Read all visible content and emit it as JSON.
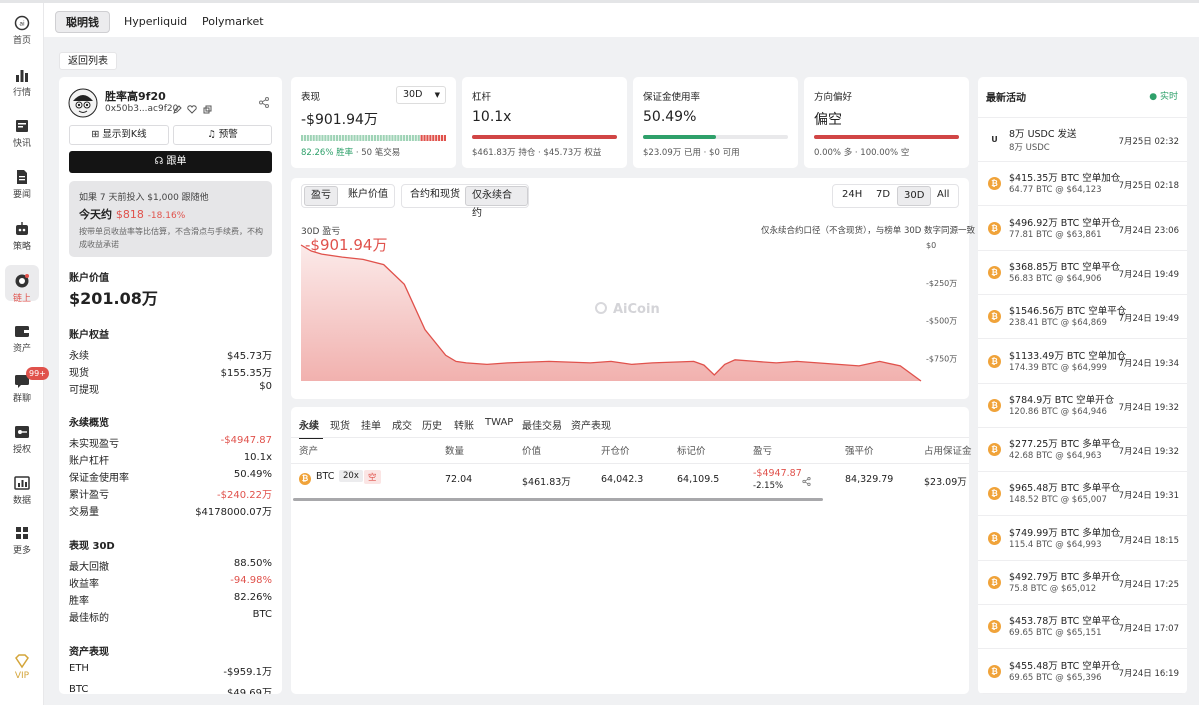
{
  "sidebar": {
    "items": [
      {
        "label": "首页",
        "icon": "ai-logo-icon"
      },
      {
        "label": "行情",
        "icon": "bar-chart-icon"
      },
      {
        "label": "快讯",
        "icon": "news-flash-icon"
      },
      {
        "label": "要闻",
        "icon": "document-icon"
      },
      {
        "label": "策略",
        "icon": "robot-icon"
      },
      {
        "label": "链上",
        "icon": "chain-icon"
      },
      {
        "label": "资产",
        "icon": "wallet-icon"
      },
      {
        "label": "群聊",
        "icon": "chat-icon",
        "badge": "99+"
      },
      {
        "label": "授权",
        "icon": "key-icon"
      },
      {
        "label": "数据",
        "icon": "data-chart-icon"
      },
      {
        "label": "更多",
        "icon": "grid-more-icon"
      },
      {
        "label": "VIP",
        "icon": "diamond-icon"
      }
    ]
  },
  "top_tabs": [
    "聪明钱",
    "Hyperliquid",
    "Polymarket"
  ],
  "back_label": "返回列表",
  "profile": {
    "name": "胜率高9f20",
    "address": "0x50b3...ac9f20",
    "kline_btn": "显示到K线",
    "alert_btn": "预警",
    "follow_btn": "跟单",
    "sim": {
      "line1": "如果 7 天前投入 $1,000 跟随他",
      "today_prefix": "今天约",
      "today_value": "$818",
      "today_pct": "-18.16%",
      "disclaimer1": "按带单员收益率等比估算，不含滑点与手续费，不构",
      "disclaimer2": "成收益承诺"
    },
    "account_value_label": "账户价值",
    "account_value": "$201.08万",
    "equity_title": "账户权益",
    "equity": [
      {
        "k": "永续",
        "v": "$45.73万"
      },
      {
        "k": "现货",
        "v": "$155.35万"
      },
      {
        "k": "可提现",
        "v": "$0"
      }
    ],
    "perp_title": "永续概览",
    "perp": [
      {
        "k": "未实现盈亏",
        "v": "-$4947.87",
        "neg": true
      },
      {
        "k": "账户杠杆",
        "v": "10.1x"
      },
      {
        "k": "保证金使用率",
        "v": "50.49%"
      },
      {
        "k": "累计盈亏",
        "v": "-$240.22万",
        "neg": true
      },
      {
        "k": "交易量",
        "v": "$4178000.07万"
      }
    ],
    "perf_title": "表现 30D",
    "perf": [
      {
        "k": "最大回撤",
        "v": "88.50%"
      },
      {
        "k": "收益率",
        "v": "-94.98%",
        "neg": true
      },
      {
        "k": "胜率",
        "v": "82.26%"
      },
      {
        "k": "最佳标的",
        "v": "BTC"
      }
    ],
    "asset_title": "资产表现",
    "assets": [
      {
        "k": "ETH",
        "v": "-$959.1万"
      },
      {
        "k": "BTC",
        "v": "$49.69万"
      }
    ]
  },
  "stats": {
    "perf": {
      "label": "表现",
      "period": "30D",
      "value": "-$901.94万",
      "win_rate": "82.26% 胜率",
      "trades": "· 50 笔交易",
      "win_fraction": 0.8226
    },
    "leverage": {
      "label": "杠杆",
      "value": "10.1x",
      "sub": "$461.83万 持仓 · $45.73万 权益",
      "fill": 1.0
    },
    "margin": {
      "label": "保证金使用率",
      "value": "50.49%",
      "sub": "$23.09万 已用 · $0 可用",
      "fill": 0.5049
    },
    "bias": {
      "label": "方向偏好",
      "value": "偏空",
      "sub": "0.00% 多 · 100.00% 空",
      "fill": 1.0
    }
  },
  "chart_panel": {
    "segs_a": [
      "盈亏",
      "账户价值"
    ],
    "segs_b": [
      "合约和现货",
      "仅永续合约"
    ],
    "ranges": [
      "24H",
      "7D",
      "30D",
      "All"
    ],
    "title": "30D 盈亏",
    "value": "-$901.94万",
    "note": "仅永续合约口径（不含现货），与榜单 30D 数字同源一致",
    "watermark": "AiCoin"
  },
  "chart_data": {
    "type": "area",
    "title": "30D 盈亏",
    "ylim": [
      -900,
      0
    ],
    "yticks": [
      "$0",
      "-$250万",
      "-$500万",
      "-$750万"
    ],
    "ytick_values": [
      0,
      -250,
      -500,
      -750
    ],
    "x": [
      0,
      0.5,
      1,
      2,
      3,
      4,
      5,
      6,
      7,
      7.5,
      8,
      9,
      10,
      11,
      12,
      13,
      14,
      15,
      16,
      17,
      18,
      19,
      19.5,
      20,
      20.5,
      21,
      22,
      23,
      24,
      25,
      26,
      27,
      28,
      29,
      30
    ],
    "values": [
      0,
      -40,
      -60,
      -80,
      -95,
      -130,
      -260,
      -560,
      -730,
      -770,
      -780,
      -790,
      -780,
      -775,
      -770,
      -775,
      -780,
      -770,
      -790,
      -780,
      -775,
      -770,
      -795,
      -860,
      -790,
      -760,
      -770,
      -780,
      -770,
      -780,
      -790,
      -800,
      -770,
      -800,
      -900
    ]
  },
  "positions": {
    "tabs": [
      "永续",
      "现货",
      "挂单",
      "成交",
      "历史",
      "转账",
      "TWAP",
      "最佳交易",
      "资产表现"
    ],
    "headers": [
      "资产",
      "数量",
      "价值",
      "开仓价",
      "标记价",
      "盈亏",
      "强平价",
      "占用保证金"
    ],
    "row": {
      "asset": "BTC",
      "lev": "20x",
      "side": "空",
      "qty": "72.04",
      "value": "$461.83万",
      "entry": "64,042.3",
      "mark": "64,109.5",
      "pnl": "-$4947.87",
      "pnl_pct": "-2.15%",
      "liq": "84,329.79",
      "margin": "$23.09万"
    }
  },
  "activity": {
    "title": "最新活动",
    "live": "● 实时",
    "items": [
      {
        "t": "8万 USDC 发送",
        "s": "8万 USDC",
        "time": "7月25日 02:32",
        "icon": "usdc"
      },
      {
        "t": "$415.35万 BTC 空单加仓",
        "s": "64.77 BTC @ $64,123",
        "time": "7月25日 02:18",
        "icon": "btc"
      },
      {
        "t": "$496.92万 BTC 空单开仓",
        "s": "77.81 BTC @ $63,861",
        "time": "7月24日 23:06",
        "icon": "btc"
      },
      {
        "t": "$368.85万 BTC 空单平仓",
        "s": "56.83 BTC @ $64,906",
        "time": "7月24日 19:49",
        "icon": "btc"
      },
      {
        "t": "$1546.56万 BTC 空单平仓",
        "s": "238.41 BTC @ $64,869",
        "time": "7月24日 19:49",
        "icon": "btc"
      },
      {
        "t": "$1133.49万 BTC 空单加仓",
        "s": "174.39 BTC @ $64,999",
        "time": "7月24日 19:34",
        "icon": "btc"
      },
      {
        "t": "$784.9万 BTC 空单开仓",
        "s": "120.86 BTC @ $64,946",
        "time": "7月24日 19:32",
        "icon": "btc"
      },
      {
        "t": "$277.25万 BTC 多单平仓",
        "s": "42.68 BTC @ $64,963",
        "time": "7月24日 19:32",
        "icon": "btc"
      },
      {
        "t": "$965.48万 BTC 多单平仓",
        "s": "148.52 BTC @ $65,007",
        "time": "7月24日 19:31",
        "icon": "btc"
      },
      {
        "t": "$749.99万 BTC 多单加仓",
        "s": "115.4 BTC @ $64,993",
        "time": "7月24日 18:15",
        "icon": "btc"
      },
      {
        "t": "$492.79万 BTC 多单开仓",
        "s": "75.8 BTC @ $65,012",
        "time": "7月24日 17:25",
        "icon": "btc"
      },
      {
        "t": "$453.78万 BTC 空单平仓",
        "s": "69.65 BTC @ $65,151",
        "time": "7月24日 17:07",
        "icon": "btc"
      },
      {
        "t": "$455.48万 BTC 空单开仓",
        "s": "69.65 BTC @ $65,396",
        "time": "7月24日 16:19",
        "icon": "btc"
      }
    ]
  },
  "colors": {
    "red": "#e0524c",
    "green": "#2ea06a",
    "btc": "#f0a33a"
  }
}
